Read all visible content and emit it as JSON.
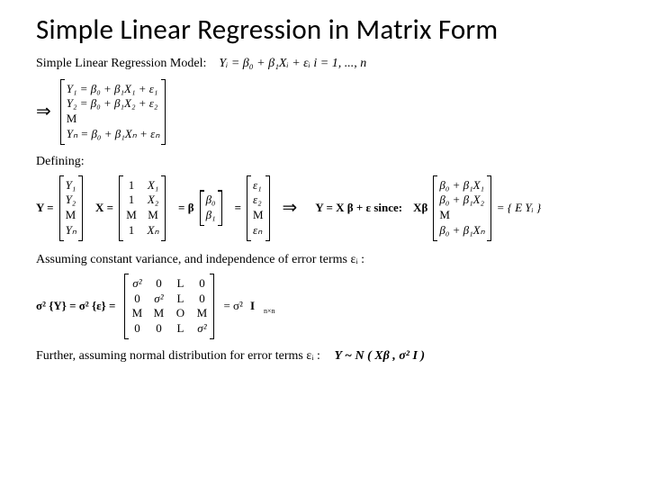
{
  "title": "Simple Linear Regression in Matrix Form",
  "model_label": "Simple Linear Regression Model:",
  "model_eq": "Yᵢ = β₀ + β₁Xᵢ + εᵢ    i = 1, ..., n",
  "system": {
    "row1": "Y₁ = β₀ + β₁X₁ + ε₁",
    "row2": "Y₂ = β₀ + β₁X₂ + ε₂",
    "row3": "M",
    "row4": "Yₙ = β₀ + β₁Xₙ + εₙ"
  },
  "defining": "Defining:",
  "Y_label": "Y =",
  "Y_vec": {
    "r1": "Y₁",
    "r2": "Y₂",
    "r3": "M",
    "r4": "Yₙ"
  },
  "X_label": "X =",
  "X_mat": {
    "r1c1": "1",
    "r1c2": "X₁",
    "r2c1": "1",
    "r2c2": "X₂",
    "r3c1": "M",
    "r3c2": "M",
    "r4c1": "1",
    "r4c2": "Xₙ"
  },
  "beta_label": "= β",
  "beta_vec": {
    "r1": "β₀",
    "r2": "β₁"
  },
  "eps_label": "=",
  "eps_vec": {
    "r1": "ε₁",
    "r2": "ε₂",
    "r3": "M",
    "r4": "εₙ"
  },
  "impl_eq": "Y = X β + ε since:",
  "Xbeta_label": "Xβ",
  "Xbeta_vec": {
    "r1": "β₀ + β₁X₁",
    "r2": "β₀ + β₁X₂",
    "r3": "M",
    "r4": "β₀ + β₁Xₙ"
  },
  "Xbeta_tail": "= { E Yᵢ }",
  "assume_var": "Assuming constant variance, and independence of error terms εᵢ :",
  "sigma_label": "σ² {Y} = σ² {ε} =",
  "sigma_mat": {
    "r1": [
      "σ²",
      "0",
      "L",
      "0"
    ],
    "r2": [
      "0",
      "σ²",
      "L",
      "0"
    ],
    "r3": [
      "M",
      "M",
      "O",
      "M"
    ],
    "r4": [
      "0",
      "0",
      "L",
      "σ²"
    ]
  },
  "sigma_rhs_pre": "= σ²",
  "sigma_rhs_I": "I",
  "sigma_rhs_sub": "n×n",
  "further": "Further, assuming normal distribution for error terms εᵢ :",
  "dist": "Y ~ N ( Xβ , σ² I )"
}
